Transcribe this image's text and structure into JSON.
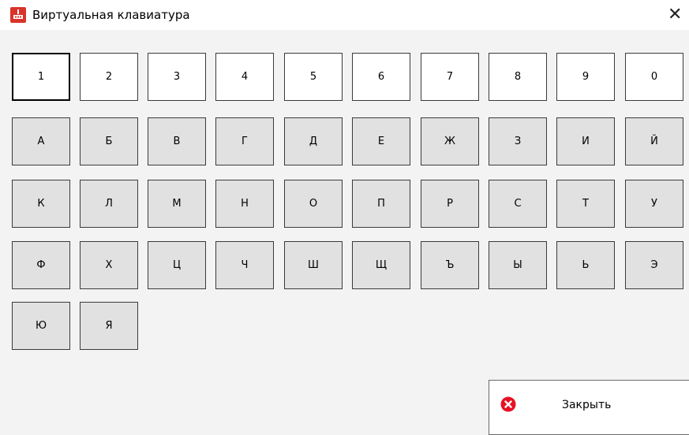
{
  "window": {
    "title": "Виртуальная клавиатура"
  },
  "keyboard": {
    "digits": [
      "1",
      "2",
      "3",
      "4",
      "5",
      "6",
      "7",
      "8",
      "9",
      "0"
    ],
    "row1": [
      "А",
      "Б",
      "В",
      "Г",
      "Д",
      "Е",
      "Ж",
      "З",
      "И",
      "Й"
    ],
    "row2": [
      "К",
      "Л",
      "М",
      "Н",
      "О",
      "П",
      "Р",
      "С",
      "Т",
      "У"
    ],
    "row3": [
      "Ф",
      "Х",
      "Ц",
      "Ч",
      "Ш",
      "Щ",
      "Ъ",
      "Ы",
      "Ь",
      "Э"
    ],
    "row4": [
      "Ю",
      "Я"
    ]
  },
  "close_button": {
    "label": "Закрыть"
  },
  "colors": {
    "accent": "#d9342b",
    "close_icon": "#e81123"
  }
}
